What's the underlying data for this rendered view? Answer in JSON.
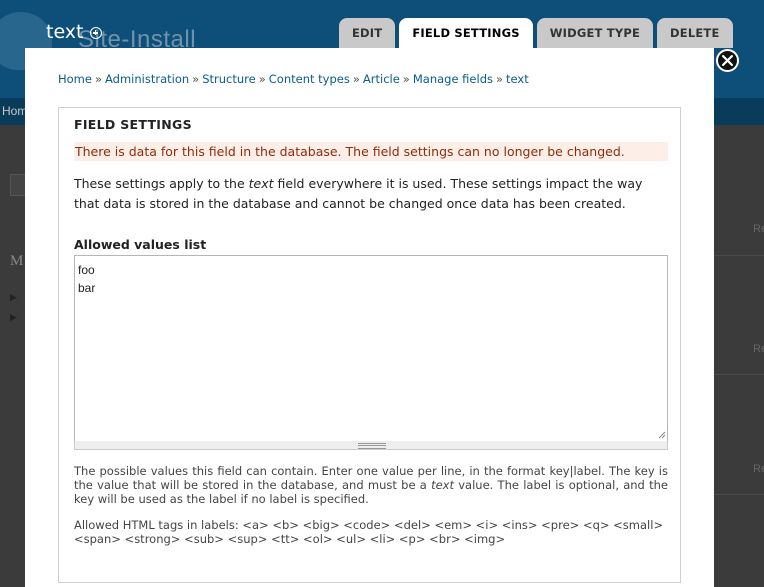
{
  "background": {
    "site_name": "Site-Install",
    "home_link": "Hom",
    "left_letter": "M",
    "right_link": "Re"
  },
  "modal": {
    "title": "text",
    "tabs": [
      {
        "label": "EDIT",
        "active": false
      },
      {
        "label": "FIELD SETTINGS",
        "active": true
      },
      {
        "label": "WIDGET TYPE",
        "active": false
      },
      {
        "label": "DELETE",
        "active": false
      }
    ]
  },
  "breadcrumb": [
    "Home",
    "Administration",
    "Structure",
    "Content types",
    "Article",
    "Manage fields",
    "text"
  ],
  "breadcrumb_separator": "»",
  "fieldset": {
    "legend": "FIELD SETTINGS",
    "warning": "There is data for this field in the database. The field settings can no longer be changed.",
    "description": {
      "before": "These settings apply to the ",
      "field_name": "text",
      "after": " field everywhere it is used. These settings impact the way that data is stored in the database and cannot be changed once data has been created."
    },
    "allowed_values_label": "Allowed values list",
    "allowed_values_text": "foo\nbar",
    "help_possible_values": {
      "before": "The possible values this field can contain. Enter one value per line, in the format key|label. The key is the value that will be stored in the database, and must be a ",
      "type_name": "text",
      "after": " value. The label is optional, and the key will be used as the label if no label is specified."
    },
    "help_allowed_tags": "Allowed HTML tags in labels: <a> <b> <big> <code> <del> <em> <i> <ins> <pre> <q> <small> <span> <strong> <sub> <sup> <tt> <ol> <ul> <li> <p> <br> <img>"
  },
  "colors": {
    "header_blue": "#0d4f79",
    "link": "#0b5c8c",
    "warning_bg": "#fdeee8",
    "warning_text": "#8c2e0b"
  }
}
